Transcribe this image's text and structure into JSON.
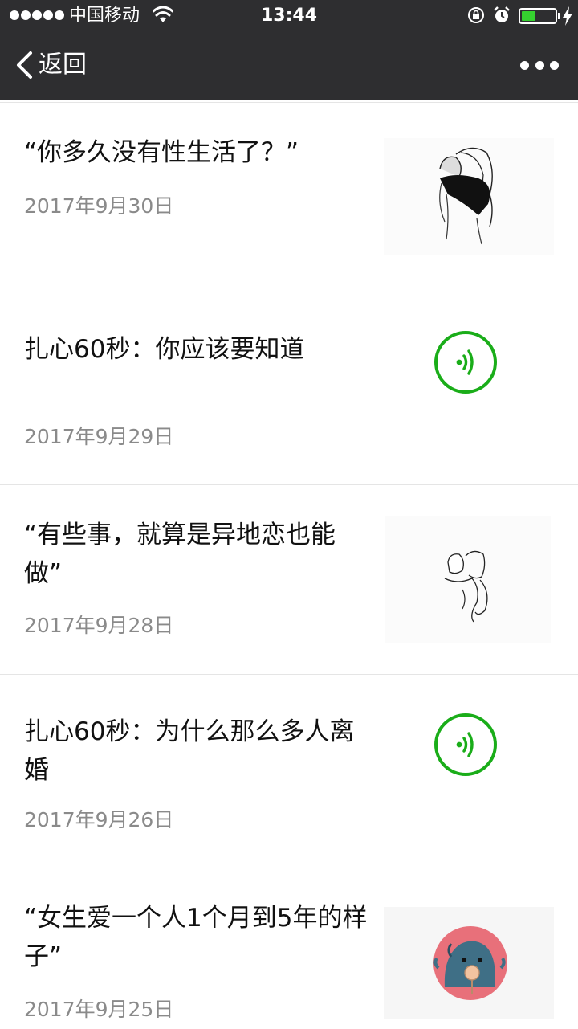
{
  "status_bar": {
    "carrier": "中国移动",
    "time": "13:44",
    "battery_level": 0.42,
    "battery_color": "#35d12f"
  },
  "nav": {
    "back_label": "返回",
    "back_icon": "chevron-left-icon",
    "more_icon": "more-dots-icon"
  },
  "articles": [
    {
      "title": "“你多久没有性生活了？”",
      "date": "2017年9月30日",
      "media": "image"
    },
    {
      "title": "扎心60秒：你应该要知道",
      "date": "2017年9月29日",
      "media": "audio"
    },
    {
      "title": "“有些事，就算是异地恋也能做”",
      "date": "2017年9月28日",
      "media": "image"
    },
    {
      "title": "扎心60秒：为什么那么多人离婚",
      "date": "2017年9月26日",
      "media": "audio"
    },
    {
      "title": "“女生爱一个人1个月到5年的样子”",
      "date": "2017年9月25日",
      "media": "image"
    }
  ],
  "colors": {
    "bar_background": "#2e2e30",
    "audio_green": "#1aad19",
    "date_gray": "#8a8a8a"
  }
}
